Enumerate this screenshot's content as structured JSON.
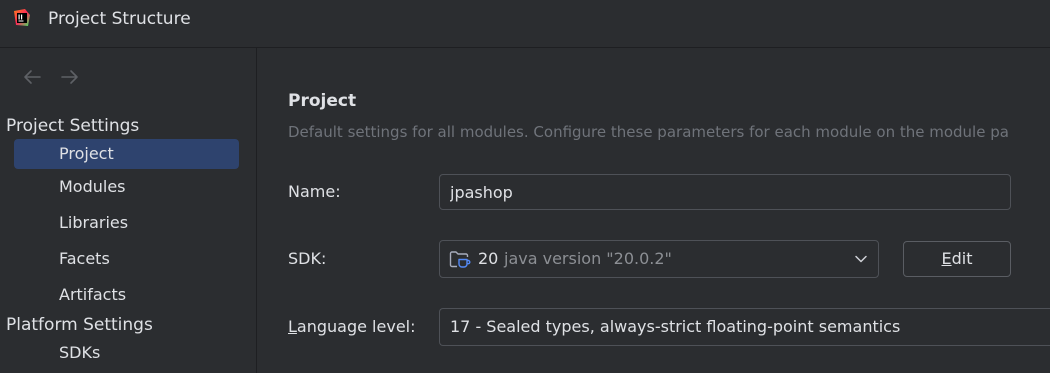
{
  "window": {
    "title": "Project Structure"
  },
  "sidebar": {
    "sections": [
      {
        "header": "Project Settings",
        "items": [
          {
            "label": "Project",
            "selected": true
          },
          {
            "label": "Modules",
            "selected": false
          },
          {
            "label": "Libraries",
            "selected": false
          },
          {
            "label": "Facets",
            "selected": false
          },
          {
            "label": "Artifacts",
            "selected": false
          }
        ]
      },
      {
        "header": "Platform Settings",
        "items": [
          {
            "label": "SDKs",
            "selected": false
          }
        ]
      }
    ]
  },
  "main": {
    "title": "Project",
    "description": "Default settings for all modules. Configure these parameters for each module on the module pa",
    "name_field": {
      "label": "Name:",
      "value": "jpashop"
    },
    "sdk_field": {
      "label": "SDK:",
      "version": "20",
      "detail": "java version \"20.0.2\"",
      "edit_label_mnemonic": "E",
      "edit_label_rest": "dit"
    },
    "language_level": {
      "label_mnemonic": "L",
      "label_rest": "anguage level:",
      "value": "17 - Sealed types, always-strict floating-point semantics"
    }
  },
  "icons": {
    "app": "intellij-idea-icon",
    "back": "arrow-left-icon",
    "forward": "arrow-right-icon",
    "sdk": "folder-java-icon",
    "dropdown": "chevron-down-icon"
  },
  "colors": {
    "background": "#2b2d30",
    "selection": "#2e436e",
    "text": "#dfe1e5",
    "muted_text": "#6f737a",
    "accent": "#3574f0"
  }
}
